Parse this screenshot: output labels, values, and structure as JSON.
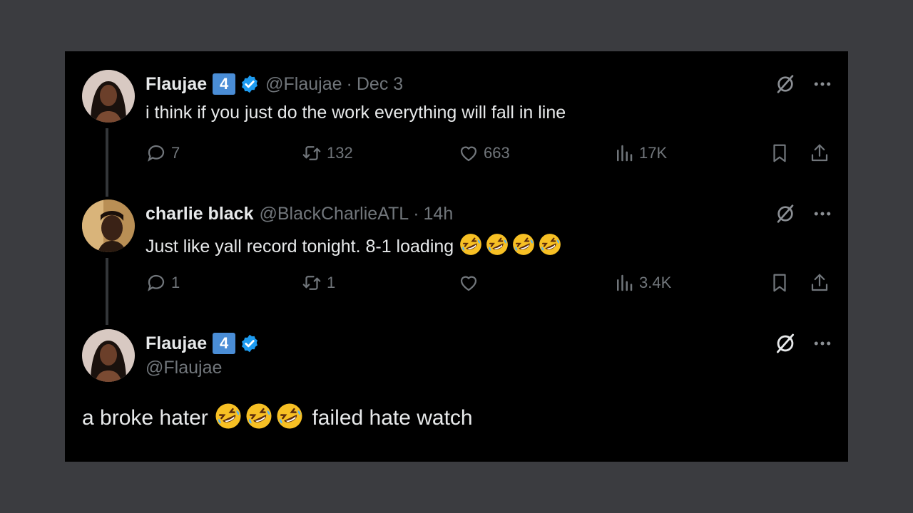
{
  "tweets": [
    {
      "name": "Flaujae",
      "badge": "4",
      "handle": "@Flaujae",
      "time": "Dec 3",
      "text": "i think if you just do the work everything will fall in line",
      "replies": "7",
      "reposts": "132",
      "likes": "663",
      "views": "17K"
    },
    {
      "name": "charlie black",
      "handle": "@BlackCharlieATL",
      "time": "14h",
      "text": "Just like yall record tonight. 8-1 loading",
      "emoji_count": 4,
      "replies": "1",
      "reposts": "1",
      "likes": "",
      "views": "3.4K"
    },
    {
      "name": "Flaujae",
      "badge": "4",
      "handle": "@Flaujae",
      "text_before": "a broke hater",
      "emoji_count": 3,
      "text_after": "failed hate watch"
    }
  ],
  "separator": "·",
  "colors": {
    "background": "#000000",
    "text": "#e7e9ea",
    "muted": "#71767b",
    "verified": "#1d9bf0",
    "badge": "#4a8dd6"
  },
  "icons": [
    "reply-icon",
    "repost-icon",
    "like-icon",
    "views-icon",
    "bookmark-icon",
    "share-icon",
    "grok-icon",
    "more-icon",
    "verified-icon",
    "rofl-emoji"
  ]
}
